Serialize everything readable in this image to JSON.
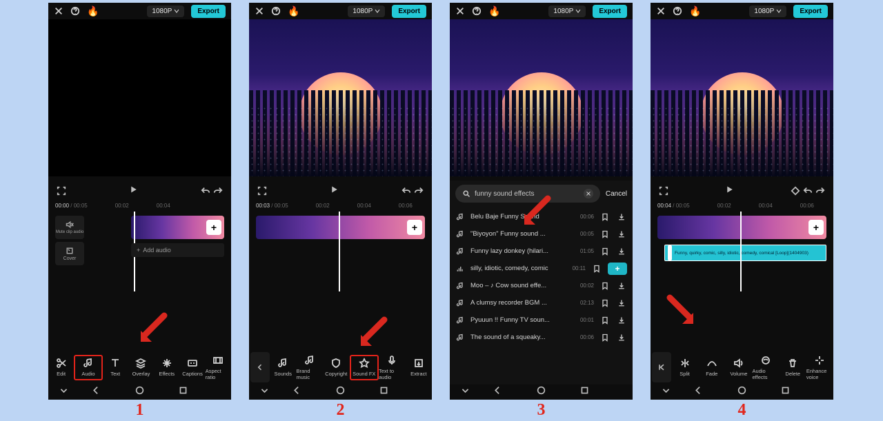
{
  "header": {
    "resolution": "1080P",
    "export": "Export"
  },
  "timeline": {
    "current1": "00:00",
    "total1": "00:05",
    "current2": "00:03",
    "total2": "00:05",
    "current4": "00:04",
    "total4": "00:05",
    "mark_a": "00:02",
    "mark_b": "00:04",
    "mark_c": "00:06",
    "mute_label": "Mute clip audio",
    "cover_label": "Cover",
    "add_audio_label": "Add audio"
  },
  "tools_main": [
    {
      "id": "edit",
      "label": "Edit"
    },
    {
      "id": "audio",
      "label": "Audio"
    },
    {
      "id": "text",
      "label": "Text"
    },
    {
      "id": "overlay",
      "label": "Overlay"
    },
    {
      "id": "effects",
      "label": "Effects"
    },
    {
      "id": "captions",
      "label": "Captions"
    },
    {
      "id": "aspect",
      "label": "Aspect ratio"
    }
  ],
  "tools_audio": [
    {
      "id": "sounds",
      "label": "Sounds"
    },
    {
      "id": "brand",
      "label": "Brand music"
    },
    {
      "id": "copyright",
      "label": "Copyright"
    },
    {
      "id": "soundfx",
      "label": "Sound FX"
    },
    {
      "id": "tta",
      "label": "Text to audio"
    },
    {
      "id": "extract",
      "label": "Extract"
    }
  ],
  "tools_clip": [
    {
      "id": "split",
      "label": "Split"
    },
    {
      "id": "fade",
      "label": "Fade"
    },
    {
      "id": "volume",
      "label": "Volume"
    },
    {
      "id": "audioeff",
      "label": "Audio effects"
    },
    {
      "id": "delete",
      "label": "Delete"
    },
    {
      "id": "enhvoice",
      "label": "Enhance voice"
    }
  ],
  "search": {
    "query": "funny sound effects",
    "cancel": "Cancel",
    "results": [
      {
        "name": "Belu Baje Funny Sound",
        "dur": "00:06",
        "type": "note",
        "action": "dl"
      },
      {
        "name": "\"Biyoyon\" Funny sound ...",
        "dur": "00:05",
        "type": "note",
        "action": "dl"
      },
      {
        "name": "Funny lazy donkey (hilari...",
        "dur": "01:05",
        "type": "note",
        "action": "dl"
      },
      {
        "name": "silly, idiotic, comedy, comic",
        "dur": "00:11",
        "type": "bars",
        "action": "add"
      },
      {
        "name": "Moo – ♪ Cow sound effe...",
        "dur": "00:02",
        "type": "note",
        "action": "dl"
      },
      {
        "name": "A clumsy recorder BGM ...",
        "dur": "02:13",
        "type": "note",
        "action": "dl"
      },
      {
        "name": "Pyuuun !! Funny TV soun...",
        "dur": "00:01",
        "type": "note",
        "action": "dl"
      },
      {
        "name": "The sound of a squeaky...",
        "dur": "00:06",
        "type": "note",
        "action": "dl"
      }
    ]
  },
  "audio_clip_label": "Funny, quirky, comic, silly, idiotic, comedy, comical [Loop](1404903)",
  "step_numbers": [
    "1",
    "2",
    "3",
    "4"
  ]
}
